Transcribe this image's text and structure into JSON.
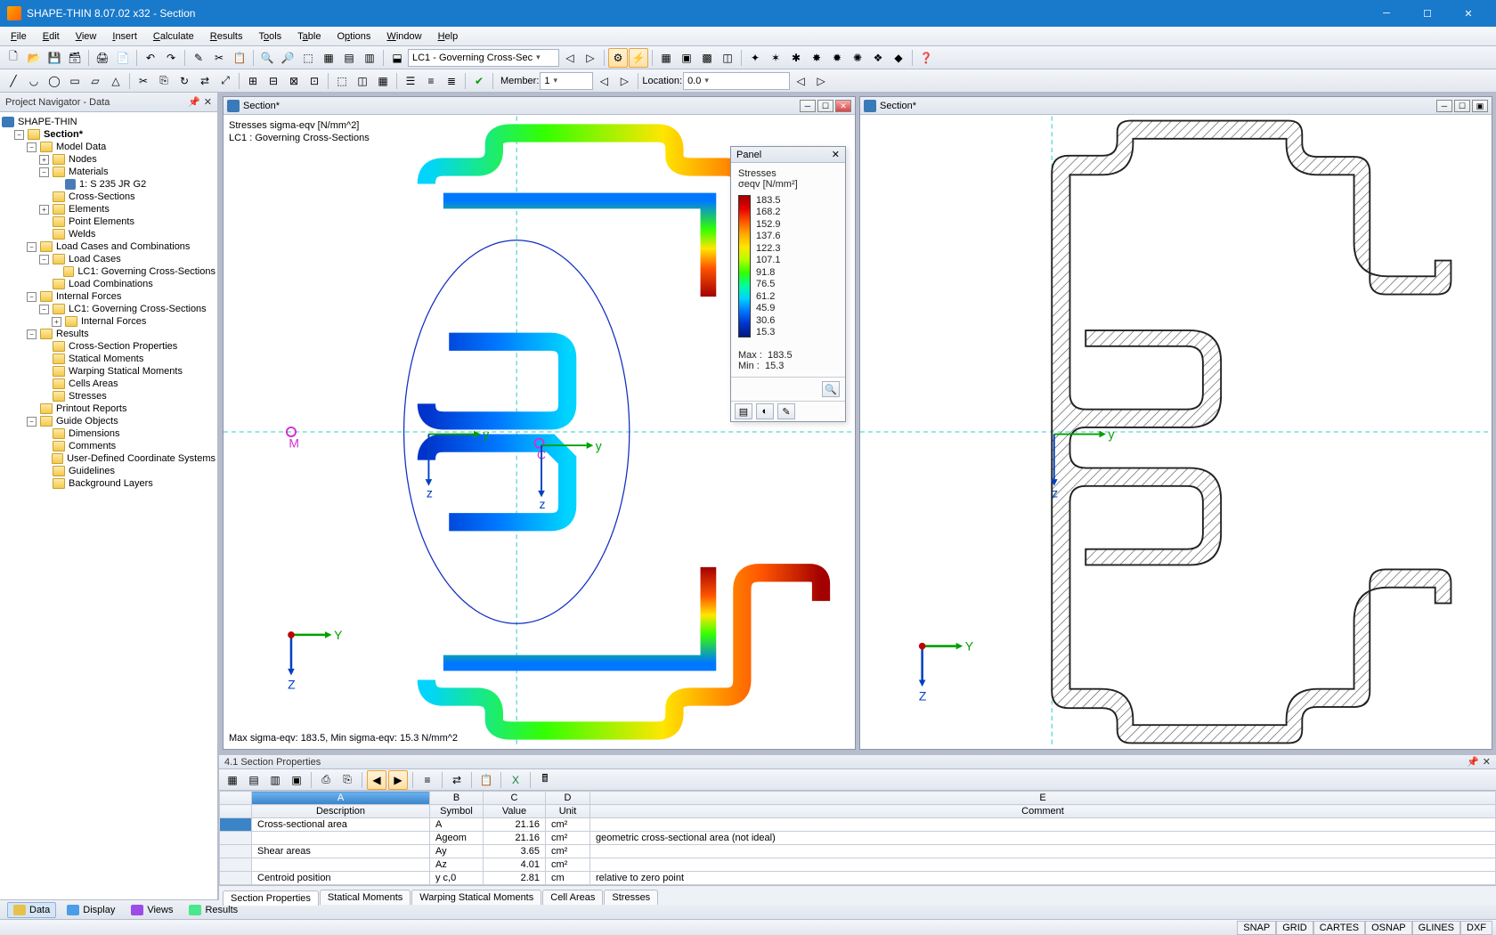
{
  "window": {
    "title": "SHAPE-THIN 8.07.02 x32 - Section"
  },
  "menu": [
    "File",
    "Edit",
    "View",
    "Insert",
    "Calculate",
    "Results",
    "Tools",
    "Table",
    "Options",
    "Window",
    "Help"
  ],
  "toolbar2": {
    "combo_lc": "LC1 - Governing Cross-Sec",
    "member_label": "Member:",
    "member_value": "1",
    "location_label": "Location:",
    "location_value": "0.0"
  },
  "navigator": {
    "title": "Project Navigator - Data",
    "root": "SHAPE-THIN",
    "section": "Section*",
    "items": {
      "model_data": "Model Data",
      "nodes": "Nodes",
      "materials": "Materials",
      "material1": "1: S 235 JR G2",
      "cross_sections": "Cross-Sections",
      "elements": "Elements",
      "point_elements": "Point Elements",
      "welds": "Welds",
      "lcc": "Load Cases and Combinations",
      "load_cases": "Load Cases",
      "lc1": "LC1: Governing Cross-Sections",
      "load_combinations": "Load Combinations",
      "internal_forces": "Internal Forces",
      "if_lc1": "LC1: Governing Cross-Sections",
      "if_inner": "Internal Forces",
      "results": "Results",
      "csp": "Cross-Section Properties",
      "sm": "Statical Moments",
      "wsm": "Warping Statical Moments",
      "ca": "Cells Areas",
      "stresses": "Stresses",
      "printout": "Printout Reports",
      "guide": "Guide Objects",
      "dims": "Dimensions",
      "comments": "Comments",
      "ucs": "User-Defined Coordinate Systems",
      "guidelines": "Guidelines",
      "bglayers": "Background Layers"
    }
  },
  "view1": {
    "title": "Section*",
    "header1": "Stresses sigma-eqv [N/mm^2]",
    "header2": "LC1 : Governing Cross-Sections",
    "footer": "Max sigma-eqv: 183.5, Min sigma-eqv: 15.3 N/mm^2"
  },
  "view2": {
    "title": "Section*"
  },
  "panel": {
    "title": "Panel",
    "line1": "Stresses",
    "line2": "σeqv [N/mm²]",
    "max_label": "Max  :",
    "max_value": "183.5",
    "min_label": "Min   :",
    "min_value": "15.3",
    "ticks": [
      "183.5",
      "168.2",
      "152.9",
      "137.6",
      "122.3",
      "107.1",
      "91.8",
      "76.5",
      "61.2",
      "45.9",
      "30.6",
      "15.3"
    ]
  },
  "grid": {
    "title": "4.1 Section Properties",
    "cols": {
      "A": "A",
      "B": "B",
      "C": "C",
      "D": "D",
      "E": "E"
    },
    "headers": {
      "desc": "Description",
      "symbol": "Symbol",
      "value": "Value",
      "unit": "Unit",
      "comment": "Comment"
    },
    "rows": [
      {
        "desc": "Cross-sectional area",
        "symbol": "A",
        "value": "21.16",
        "unit": "cm²",
        "comment": ""
      },
      {
        "desc": "",
        "symbol": "Ageom",
        "value": "21.16",
        "unit": "cm²",
        "comment": "geometric cross-sectional area (not ideal)"
      },
      {
        "desc": "Shear areas",
        "symbol": "Ay",
        "value": "3.65",
        "unit": "cm²",
        "comment": ""
      },
      {
        "desc": "",
        "symbol": "Az",
        "value": "4.01",
        "unit": "cm²",
        "comment": ""
      },
      {
        "desc": "Centroid position",
        "symbol": "y c,0",
        "value": "2.81",
        "unit": "cm",
        "comment": "relative to zero point"
      }
    ],
    "tabs": [
      "Section Properties",
      "Statical Moments",
      "Warping Statical Moments",
      "Cell Areas",
      "Stresses"
    ]
  },
  "bottomtabs": [
    "Data",
    "Display",
    "Views",
    "Results"
  ],
  "status": [
    "SNAP",
    "GRID",
    "CARTES",
    "OSNAP",
    "GLINES",
    "DXF"
  ],
  "chart_data": {
    "type": "heatmap",
    "title": "Stresses sigma-eqv [N/mm^2] — LC1 : Governing Cross-Sections",
    "colorbar": {
      "label": "σeqv [N/mm²]",
      "min": 15.3,
      "max": 183.5,
      "ticks": [
        183.5,
        168.2,
        152.9,
        137.6,
        122.3,
        107.1,
        91.8,
        76.5,
        61.2,
        45.9,
        30.6,
        15.3
      ]
    },
    "stats": {
      "max": 183.5,
      "min": 15.3,
      "unit": "N/mm^2"
    }
  }
}
